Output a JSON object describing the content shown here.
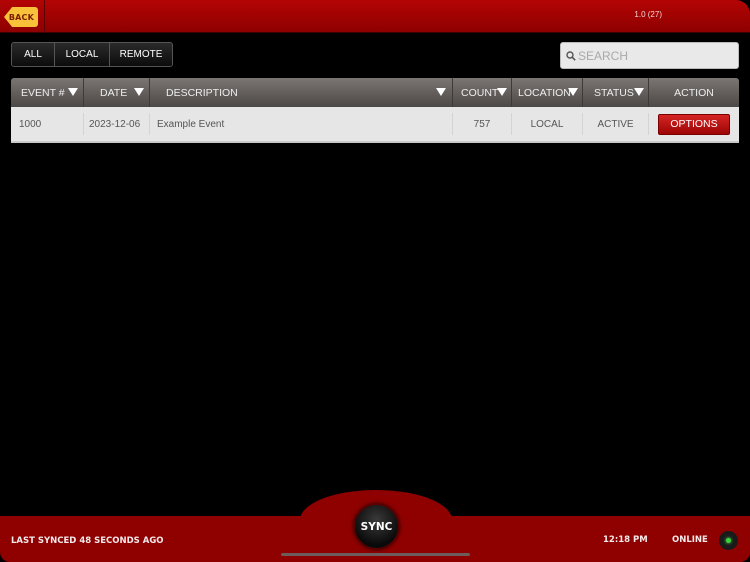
{
  "topbar": {
    "back_label": "BACK",
    "version": "1.0 (27)"
  },
  "filters": [
    {
      "label": "ALL"
    },
    {
      "label": "LOCAL"
    },
    {
      "label": "REMOTE"
    }
  ],
  "search": {
    "placeholder": "SEARCH",
    "value": ""
  },
  "table": {
    "columns": [
      {
        "label": "EVENT #",
        "sortable": true
      },
      {
        "label": "DATE",
        "sortable": true
      },
      {
        "label": "DESCRIPTION",
        "sortable": true
      },
      {
        "label": "COUNT",
        "sortable": true
      },
      {
        "label": "LOCATION",
        "sortable": true
      },
      {
        "label": "STATUS",
        "sortable": true
      },
      {
        "label": "ACTION",
        "sortable": false
      }
    ],
    "rows": [
      {
        "event": "1000",
        "date": "2023-12-06",
        "description": "Example Event",
        "count": "757",
        "location": "LOCAL",
        "status": "ACTIVE",
        "action_label": "OPTIONS"
      }
    ]
  },
  "footer": {
    "last_synced": "LAST SYNCED 48 SECONDS AGO",
    "sync_label": "SYNC",
    "time": "12:18 PM",
    "connection": "ONLINE",
    "connection_color": "#3bd43b"
  },
  "colors": {
    "brand_red": "#8f0000",
    "back_button": "#f7c23a",
    "options_button": "#c01414"
  }
}
